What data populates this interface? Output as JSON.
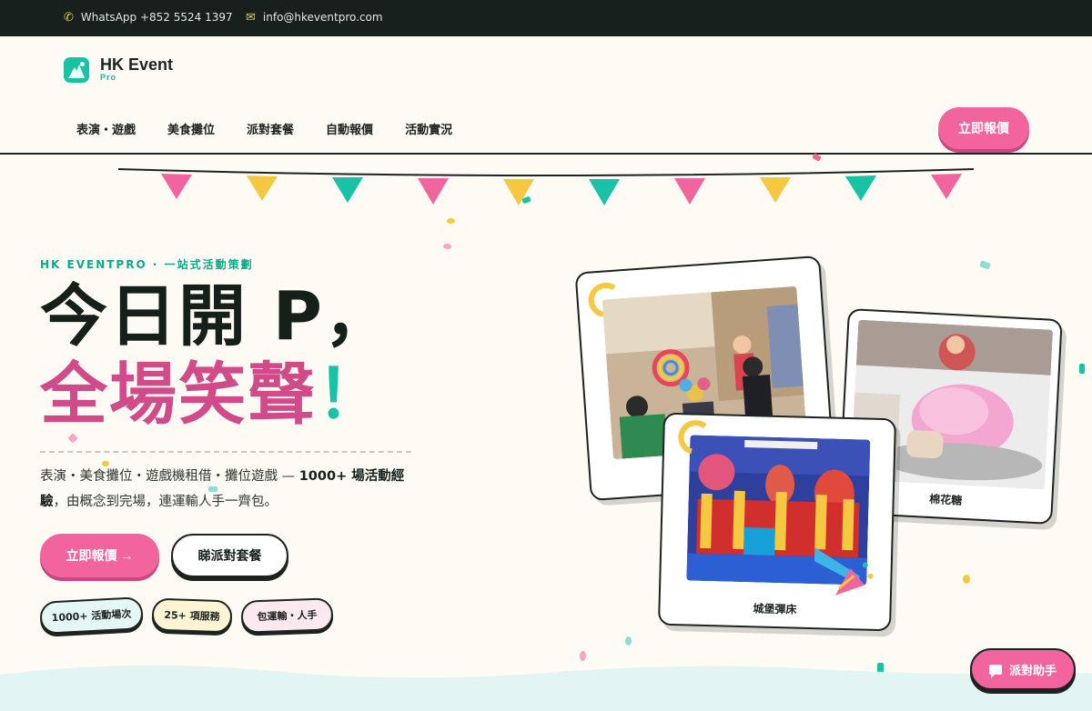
{
  "topbar": {
    "whatsapp": "WhatsApp +852 5524 1397",
    "email": "info@hkeventpro.com",
    "icons": {
      "phone": "phone-icon",
      "mail": "mail-icon"
    }
  },
  "brand": {
    "name": "HK Event",
    "sub": "Pro"
  },
  "nav": {
    "items": [
      "表演・遊戲",
      "美食攤位",
      "派對套餐",
      "自動報價",
      "活動實況"
    ],
    "cta": "立即報價"
  },
  "hero": {
    "eyebrow": "HK EVENTPRO · 一站式活動策劃",
    "title_line1": "今日開 P，",
    "title_line2": "全場笑聲",
    "title_bang": "！",
    "desc_pre": "表演・美食攤位・遊戲機租借・攤位遊戲 — ",
    "desc_bold": "1000+ 場活動經驗",
    "desc_post": "，由概念到完場，連運輸人手一齊包。",
    "btn_primary": "立即報價 →",
    "btn_secondary": "睇派對套餐",
    "chips": [
      "1000+ 活動場次",
      "25+ 項服務",
      "包運輸・人手"
    ]
  },
  "cards": [
    {
      "caption": ""
    },
    {
      "caption": "棉花糖"
    },
    {
      "caption": "城堡彈床"
    }
  ],
  "fab": {
    "label": "派對助手",
    "icon": "chat-icon"
  },
  "colors": {
    "pink": "#f2649d",
    "teal": "#19c2a4",
    "yellow": "#f5c842",
    "dark": "#17201c",
    "cream": "#fdfbf4"
  }
}
